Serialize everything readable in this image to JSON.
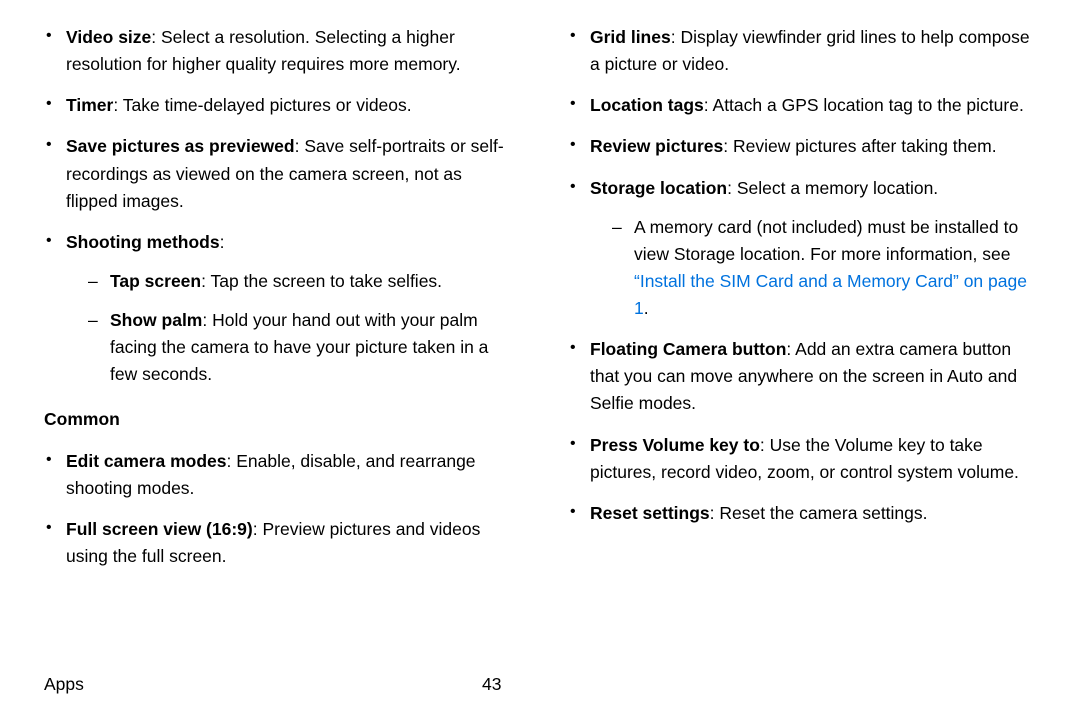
{
  "left": {
    "items": [
      {
        "label": "Video size",
        "desc": ": Select a resolution. Selecting a higher resolution for higher quality requires more memory."
      },
      {
        "label": "Timer",
        "desc": ": Take time-delayed pictures or videos."
      },
      {
        "label": "Save pictures as previewed",
        "desc": ": Save self-portraits or self-recordings as viewed on the camera screen, not as flipped images."
      },
      {
        "label": "Shooting methods",
        "desc": ":"
      }
    ],
    "shooting_sub": [
      {
        "label": "Tap screen",
        "desc": ": Tap the screen to take selfies."
      },
      {
        "label": "Show palm",
        "desc": ": Hold your hand out with your palm facing the camera to have your picture taken in a few seconds."
      }
    ],
    "common_heading": "Common",
    "common_items": [
      {
        "label": "Edit camera modes",
        "desc": ": Enable, disable, and rearrange shooting modes."
      },
      {
        "label": "Full screen view (16:9)",
        "desc": ": Preview pictures and videos using the full screen."
      }
    ]
  },
  "right": {
    "items": [
      {
        "label": "Grid lines",
        "desc": ": Display viewfinder grid lines to help compose a picture or video."
      },
      {
        "label": "Location tags",
        "desc": ": Attach a GPS location tag to the picture."
      },
      {
        "label": "Review pictures",
        "desc": ": Review pictures after taking them."
      },
      {
        "label": "Storage location",
        "desc": ": Select a memory location."
      }
    ],
    "storage_sub": {
      "pre": "A memory card (not included) must be installed to view Storage location. For more information, see ",
      "link": "“Install the SIM Card and a Memory Card” on page 1",
      "post": "."
    },
    "items2": [
      {
        "label": "Floating Camera button",
        "desc": ": Add an extra camera button that you can move anywhere on the screen in Auto and Selfie modes."
      },
      {
        "label": "Press Volume key to",
        "desc": ": Use the Volume key to take pictures, record video, zoom, or control system volume."
      },
      {
        "label": "Reset settings",
        "desc": ": Reset the camera settings."
      }
    ]
  },
  "footer": {
    "section": "Apps",
    "page": "43"
  }
}
